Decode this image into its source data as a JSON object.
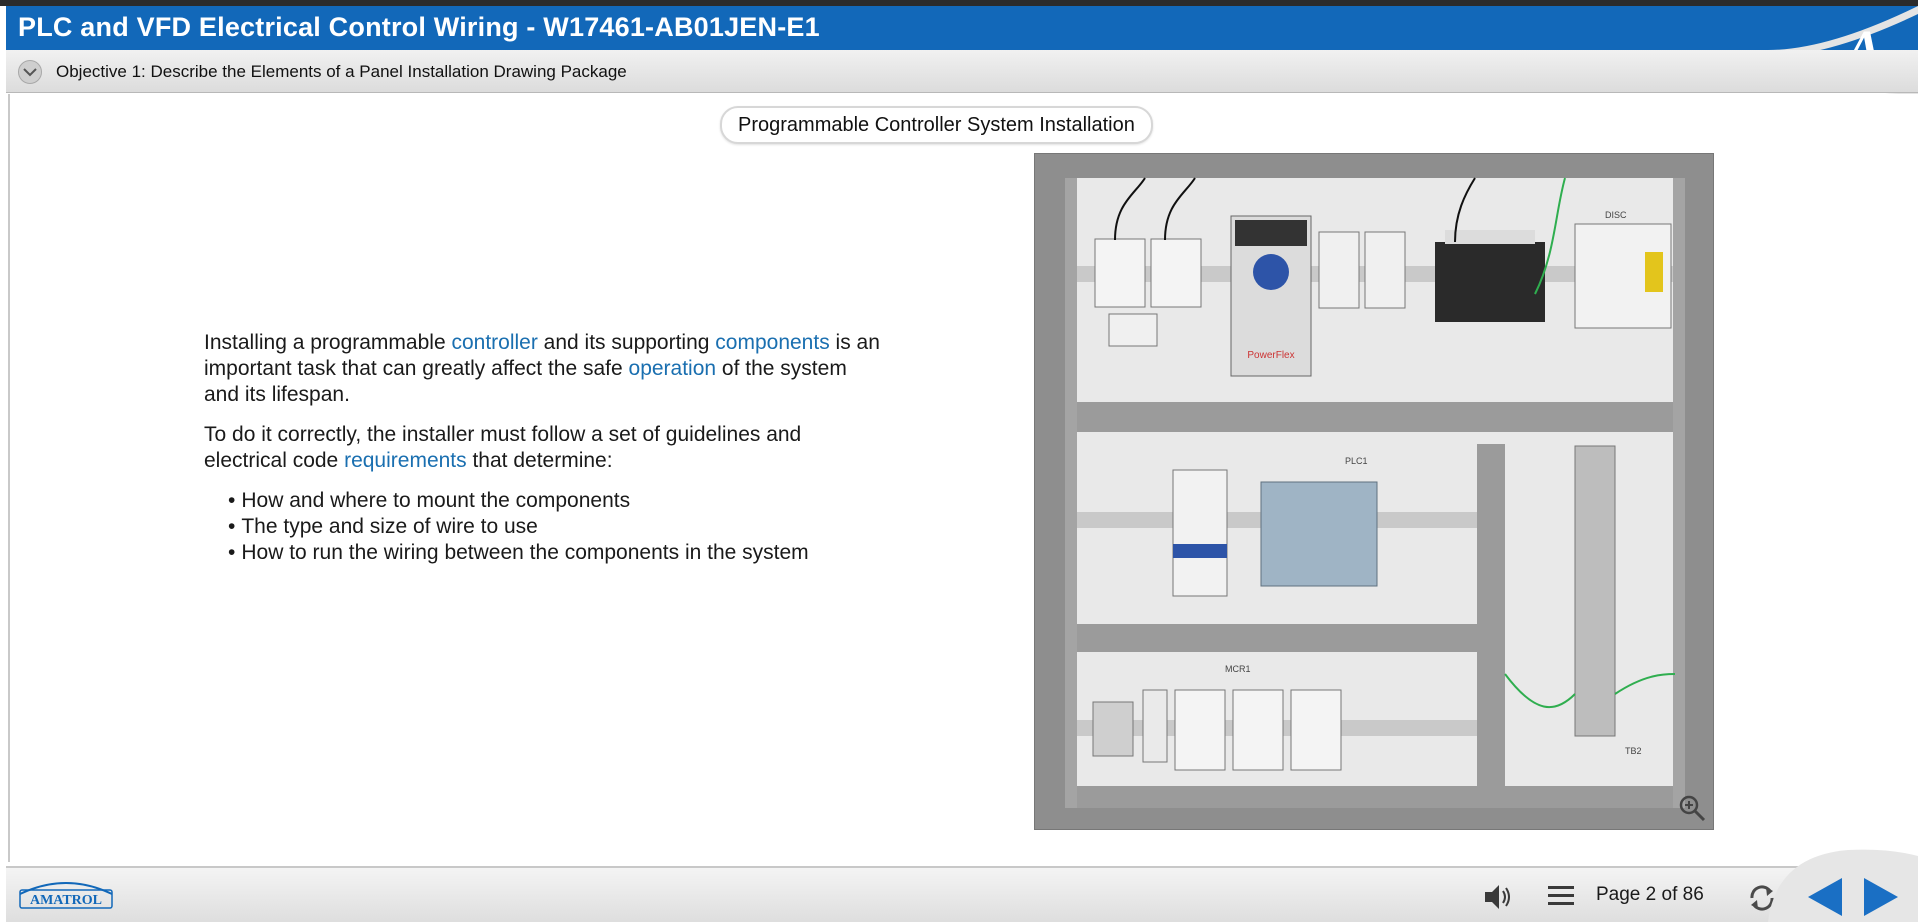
{
  "header": {
    "title": "PLC and VFD Electrical Control Wiring - W17461-AB01JEN-E1",
    "logo_letter": "A",
    "accent": "#1268b9"
  },
  "objective": {
    "text": "Objective 1: Describe the Elements of a Panel Installation Drawing Package",
    "toggle_icon": "chevron-down-icon"
  },
  "slide": {
    "title": "Programmable Controller System Installation",
    "para1": {
      "t1": "Installing a programmable ",
      "l1": "controller",
      "t2": " and its supporting ",
      "l2": "components",
      "t3": " is an important task that can greatly affect the safe ",
      "l3": "operation",
      "t4": " of the system and its lifespan."
    },
    "para2": {
      "t1": "To do it correctly, the installer must follow a set of guidelines and electrical code ",
      "l1": "requirements",
      "t2": " that determine:"
    },
    "bullets": [
      "How and where to mount the components",
      "The type and size of wire to use",
      "How to run the wiring between the components in the system"
    ],
    "link_color": "#1a6fb0",
    "photo": {
      "labels": [
        "PowerFlex",
        "PLC1",
        "MCR1",
        "TB2",
        "DISC"
      ],
      "zoom_icon": "zoom-in-icon"
    }
  },
  "footer": {
    "brand": "AMATROL",
    "page_label": "Page 2 of 86",
    "icons": [
      "audio-icon",
      "menu-icon",
      "refresh-icon",
      "back-arrow-icon",
      "next-arrow-icon"
    ]
  }
}
